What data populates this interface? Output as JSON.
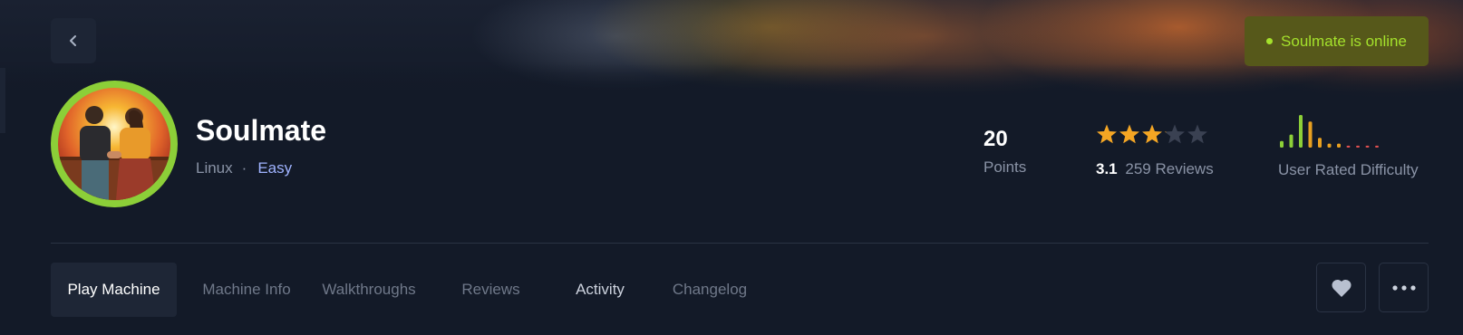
{
  "machine": {
    "name": "Soulmate",
    "os": "Linux",
    "separator": "·",
    "difficulty": "Easy"
  },
  "status": {
    "text": "Soulmate is online",
    "color": "#a4e12c"
  },
  "stats": {
    "points_value": "20",
    "points_label": "Points",
    "rating_value": "3.1",
    "rating_stars_fraction": 0.62,
    "reviews_text": "259 Reviews",
    "difficulty_label": "User Rated Difficulty",
    "difficulty_bars": [
      1,
      2,
      5,
      4,
      1.5,
      0.6,
      0.6,
      0.3,
      0.3,
      0.3,
      0.3
    ],
    "difficulty_bar_colors": [
      "#8ccf38",
      "#8ccf38",
      "#8ccf38",
      "#e8a020",
      "#e8a020",
      "#e8a020",
      "#e8a020",
      "#e05050",
      "#e05050",
      "#e05050",
      "#e05050"
    ]
  },
  "tabs": [
    {
      "label": "Play Machine"
    },
    {
      "label": "Machine Info"
    },
    {
      "label": "Walkthroughs"
    },
    {
      "label": "Reviews"
    },
    {
      "label": "Activity"
    },
    {
      "label": "Changelog"
    }
  ],
  "icons": {
    "back": "chevron-left-icon",
    "favorite": "heart-icon",
    "more": "more-horizontal-icon",
    "star": "star-icon"
  },
  "colors": {
    "background": "#131a28",
    "accent_green": "#8ccf38",
    "star": "#f5a623",
    "difficulty_text": "#9fb3ff"
  }
}
